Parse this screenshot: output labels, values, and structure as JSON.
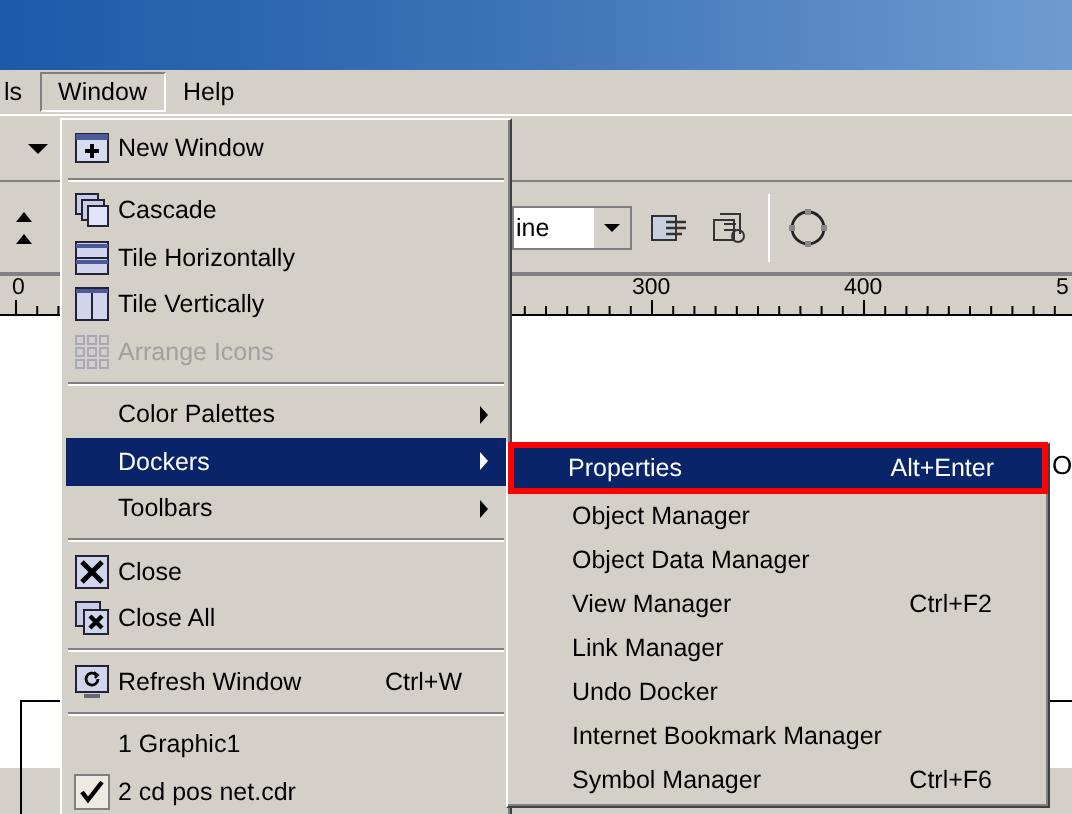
{
  "menu_bar": [
    {
      "label": "ls",
      "selected": false
    },
    {
      "label": "Window",
      "selected": true
    },
    {
      "label": "Help",
      "selected": false
    }
  ],
  "toolbar": {
    "line_style": "ine"
  },
  "ruler": {
    "labels": [
      "0",
      "300",
      "400",
      "5"
    ]
  },
  "canvas_text": "O",
  "window_menu": [
    {
      "kind": "item",
      "label": "New Window",
      "disabled": false,
      "selected": false,
      "checked": false,
      "submenu": false
    },
    {
      "kind": "separator"
    },
    {
      "kind": "item",
      "label": "Cascade",
      "disabled": false,
      "selected": false,
      "checked": false,
      "submenu": false
    },
    {
      "kind": "item",
      "label": "Tile Horizontally",
      "disabled": false,
      "selected": false,
      "checked": false,
      "submenu": false
    },
    {
      "kind": "item",
      "label": "Tile Vertically",
      "disabled": false,
      "selected": false,
      "checked": false,
      "submenu": false
    },
    {
      "kind": "item",
      "label": "Arrange Icons",
      "disabled": true,
      "selected": false,
      "checked": false,
      "submenu": false
    },
    {
      "kind": "separator"
    },
    {
      "kind": "item",
      "label": "Color Palettes",
      "disabled": false,
      "selected": false,
      "checked": false,
      "submenu": true
    },
    {
      "kind": "item",
      "label": "Dockers",
      "disabled": false,
      "selected": true,
      "checked": false,
      "submenu": true
    },
    {
      "kind": "item",
      "label": "Toolbars",
      "disabled": false,
      "selected": false,
      "checked": false,
      "submenu": true
    },
    {
      "kind": "separator"
    },
    {
      "kind": "item",
      "label": "Close",
      "disabled": false,
      "selected": false,
      "checked": false,
      "submenu": false
    },
    {
      "kind": "item",
      "label": "Close All",
      "disabled": false,
      "selected": false,
      "checked": false,
      "submenu": false
    },
    {
      "kind": "separator"
    },
    {
      "kind": "item",
      "label": "Refresh Window",
      "shortcut": "Ctrl+W",
      "disabled": false,
      "selected": false,
      "checked": false,
      "submenu": false
    },
    {
      "kind": "separator"
    },
    {
      "kind": "item",
      "label": "1 Graphic1",
      "disabled": false,
      "selected": false,
      "checked": false,
      "submenu": false
    },
    {
      "kind": "item",
      "label": "2 cd pos net.cdr",
      "disabled": false,
      "selected": false,
      "checked": true,
      "submenu": false
    }
  ],
  "dockers_menu": [
    {
      "label": "Properties",
      "shortcut": "Alt+Enter",
      "selected": true,
      "outlined": true
    },
    {
      "label": "Object Manager",
      "selected": false,
      "outlined": false
    },
    {
      "label": "Object Data Manager",
      "selected": false,
      "outlined": false
    },
    {
      "label": "View Manager",
      "shortcut": "Ctrl+F2",
      "selected": false,
      "outlined": false
    },
    {
      "label": "Link Manager",
      "selected": false,
      "outlined": false
    },
    {
      "label": "Undo Docker",
      "selected": false,
      "outlined": false
    },
    {
      "label": "Internet Bookmark Manager",
      "selected": false,
      "outlined": false
    },
    {
      "label": "Symbol Manager",
      "shortcut": "Ctrl+F6",
      "selected": false,
      "outlined": false
    }
  ]
}
